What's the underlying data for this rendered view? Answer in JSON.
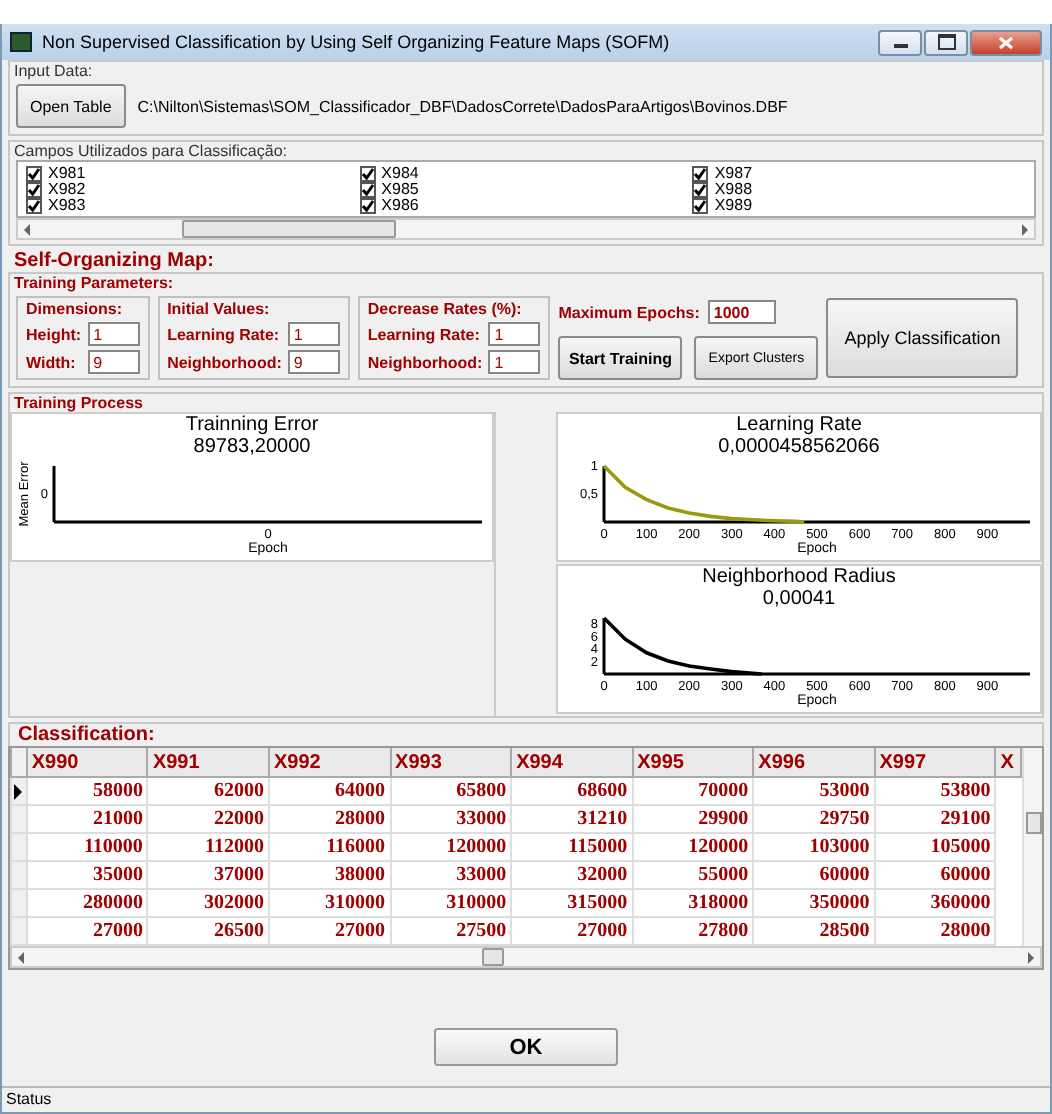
{
  "window": {
    "title": "Non Supervised Classification by Using Self Organizing Feature Maps (SOFM)"
  },
  "input_data": {
    "label": "Input Data:",
    "open_button": "Open Table",
    "path": "C:\\Nilton\\Sistemas\\SOM_Classificador_DBF\\DadosCorrete\\DadosParaArtigos\\Bovinos.DBF"
  },
  "fields_group": {
    "label": "Campos Utilizados para Classificação:",
    "fields": [
      {
        "label": "X981",
        "checked": true
      },
      {
        "label": "X982",
        "checked": true
      },
      {
        "label": "X983",
        "checked": true
      },
      {
        "label": "X984",
        "checked": true
      },
      {
        "label": "X985",
        "checked": true
      },
      {
        "label": "X986",
        "checked": true
      },
      {
        "label": "X987",
        "checked": true
      },
      {
        "label": "X988",
        "checked": true
      },
      {
        "label": "X989",
        "checked": true
      }
    ]
  },
  "som": {
    "label": "Self-Organizing Map:",
    "params_label": "Training Parameters:",
    "groups": [
      {
        "label": "Dimensions:",
        "inputs": [
          {
            "label": "Height:",
            "value": "1"
          },
          {
            "label": "Width:",
            "value": "9"
          }
        ]
      },
      {
        "label": "Initial Values:",
        "inputs": [
          {
            "label": "Learning Rate:",
            "value": "1"
          },
          {
            "label": "Neighborhood:",
            "value": "9"
          }
        ]
      },
      {
        "label": "Decrease Rates (%):",
        "inputs": [
          {
            "label": "Learning Rate:",
            "value": "1"
          },
          {
            "label": "Neighborhood:",
            "value": "1"
          }
        ]
      }
    ],
    "max_epochs": {
      "label": "Maximum Epochs:",
      "value": "1000"
    },
    "buttons": [
      {
        "label": "Start Training",
        "kind": "bold"
      },
      {
        "label": "Export Clusters",
        "kind": "plain"
      },
      {
        "label": "Apply Classification",
        "kind": "large"
      }
    ]
  },
  "training": {
    "label": "Training Process",
    "charts": [
      {
        "reading": "89783,20000",
        "empty_plot": {
          "title": "Trainning Error",
          "xlabel": "Epoch",
          "ylabel": "Mean Error",
          "x_tick": "0",
          "y_tick": "0"
        }
      },
      {
        "reading": "0,0000458562066",
        "chart_data": {
          "type": "line",
          "title": "Learning Rate",
          "xlabel": "Epoch",
          "x": [
            0,
            50,
            100,
            150,
            200,
            250,
            300,
            350,
            400,
            450,
            470
          ],
          "series": [
            {
              "color": "#9a9a10",
              "values": [
                1,
                0.62,
                0.4,
                0.25,
                0.16,
                0.1,
                0.06,
                0.04,
                0.02,
                0.01,
                0
              ]
            }
          ],
          "xlim": [
            0,
            1000
          ],
          "ylim": [
            0,
            1
          ],
          "xticks": [
            0,
            100,
            200,
            300,
            400,
            500,
            600,
            700,
            800,
            900
          ],
          "yticks": [
            {
              "value": 0.5,
              "label": "0,5"
            },
            1
          ]
        }
      },
      {
        "reading": "0,00041",
        "chart_data": {
          "type": "line",
          "title": "Neighborhood Radius",
          "xlabel": "Epoch",
          "x": [
            0,
            50,
            100,
            150,
            200,
            250,
            300,
            350,
            370
          ],
          "series": [
            {
              "color": "#000000",
              "values": [
                9,
                5.6,
                3.4,
                2.1,
                1.3,
                0.8,
                0.4,
                0.1,
                0
              ]
            }
          ],
          "xlim": [
            0,
            1000
          ],
          "ylim": [
            0,
            9
          ],
          "xticks": [
            0,
            100,
            200,
            300,
            400,
            500,
            600,
            700,
            800,
            900
          ],
          "yticks": [
            2,
            4,
            6,
            8
          ]
        }
      }
    ]
  },
  "classification": {
    "label": "Classification:",
    "columns": [
      "X990",
      "X991",
      "X992",
      "X993",
      "X994",
      "X995",
      "X996",
      "X997",
      "X"
    ],
    "rows": [
      {
        "selected": true,
        "cells": [
          "58000",
          "62000",
          "64000",
          "65800",
          "68600",
          "70000",
          "53000",
          "53800"
        ]
      },
      {
        "selected": false,
        "cells": [
          "21000",
          "22000",
          "28000",
          "33000",
          "31210",
          "29900",
          "29750",
          "29100"
        ]
      },
      {
        "selected": false,
        "cells": [
          "110000",
          "112000",
          "116000",
          "120000",
          "115000",
          "120000",
          "103000",
          "105000"
        ]
      },
      {
        "selected": false,
        "cells": [
          "35000",
          "37000",
          "38000",
          "33000",
          "32000",
          "55000",
          "60000",
          "60000"
        ]
      },
      {
        "selected": false,
        "cells": [
          "280000",
          "302000",
          "310000",
          "310000",
          "315000",
          "318000",
          "350000",
          "360000"
        ]
      },
      {
        "selected": false,
        "cells": [
          "27000",
          "26500",
          "27000",
          "27500",
          "27000",
          "27800",
          "28500",
          "28000"
        ]
      }
    ]
  },
  "ok_button": "OK",
  "status_bar": "Status"
}
